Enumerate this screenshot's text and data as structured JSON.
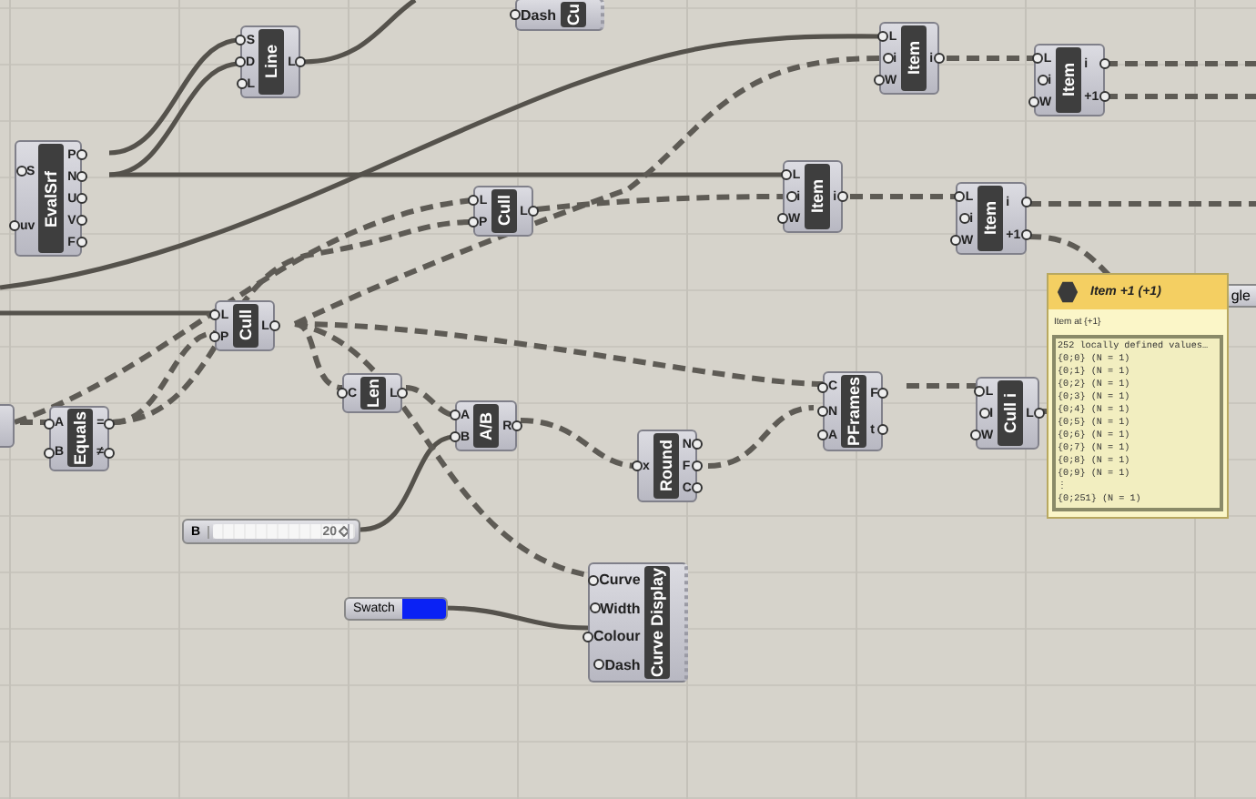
{
  "nodes": [
    {
      "kind": "display",
      "label": "Cu",
      "inputs": [
        "Dash"
      ]
    },
    {
      "kind": "component",
      "label": "Line",
      "inputs": [
        "S",
        "D",
        "L"
      ],
      "outputs": [
        "L"
      ]
    },
    {
      "kind": "component",
      "label": "EvalSrf",
      "inputs": [
        "S",
        "uv"
      ],
      "outputs": [
        "P",
        "N",
        "U",
        "V",
        "F"
      ]
    },
    {
      "kind": "component",
      "label": "Cull",
      "inputs": [
        "L",
        "P"
      ],
      "outputs": [
        "L"
      ]
    },
    {
      "kind": "component",
      "label": "Item",
      "inputs": [
        "L",
        "i",
        "W"
      ],
      "outputs": [
        "i"
      ]
    },
    {
      "kind": "component",
      "label": "Item",
      "inputs": [
        "L",
        "i",
        "W"
      ],
      "outputs": [
        "i",
        "+1"
      ]
    },
    {
      "kind": "component",
      "label": "Item",
      "inputs": [
        "L",
        "i",
        "W"
      ],
      "outputs": [
        "i"
      ]
    },
    {
      "kind": "component",
      "label": "Item",
      "inputs": [
        "L",
        "i",
        "W"
      ],
      "outputs": [
        "i",
        "+1"
      ]
    },
    {
      "kind": "component",
      "label": "Cull",
      "inputs": [
        "L",
        "P"
      ],
      "outputs": [
        "L"
      ]
    },
    {
      "kind": "component",
      "label": "Equals",
      "inputs": [
        "A",
        "B"
      ],
      "outputs": [
        "=",
        "≠"
      ]
    },
    {
      "kind": "component",
      "label": "Len",
      "inputs": [
        "C"
      ],
      "outputs": [
        "L"
      ]
    },
    {
      "kind": "component",
      "label": "A/B",
      "inputs": [
        "A",
        "B"
      ],
      "outputs": [
        "R"
      ]
    },
    {
      "kind": "component",
      "label": "Round",
      "inputs": [
        "x"
      ],
      "outputs": [
        "N",
        "F",
        "C"
      ]
    },
    {
      "kind": "component",
      "label": "PFrames",
      "inputs": [
        "C",
        "N",
        "A"
      ],
      "outputs": [
        "F",
        "t"
      ]
    },
    {
      "kind": "component",
      "label": "Cull i",
      "inputs": [
        "L",
        "I",
        "W"
      ],
      "outputs": [
        "L"
      ]
    },
    {
      "kind": "display",
      "label": "Curve Display",
      "inputs": [
        "Curve",
        "Width",
        "Colour",
        "Dash"
      ]
    }
  ],
  "slider": {
    "name": "B",
    "value": "20",
    "level": 0.95
  },
  "swatch": {
    "label": "Swatch",
    "color": "#0a22f5"
  },
  "partial_node": {
    "text": "gle"
  },
  "tooltip": {
    "title": "Item +1 (+1)",
    "subtitle": "Item at {+1}",
    "lines": [
      "252 locally defined values…",
      "{0;0} (N = 1)",
      "{0;1} (N = 1)",
      "{0;2} (N = 1)",
      "{0;3} (N = 1)",
      "{0;4} (N = 1)",
      "{0;5} (N = 1)",
      "{0;6} (N = 1)",
      "{0;7} (N = 1)",
      "{0;8} (N = 1)",
      "{0;9} (N = 1)",
      "⋮",
      "{0;251} (N = 1)"
    ]
  }
}
